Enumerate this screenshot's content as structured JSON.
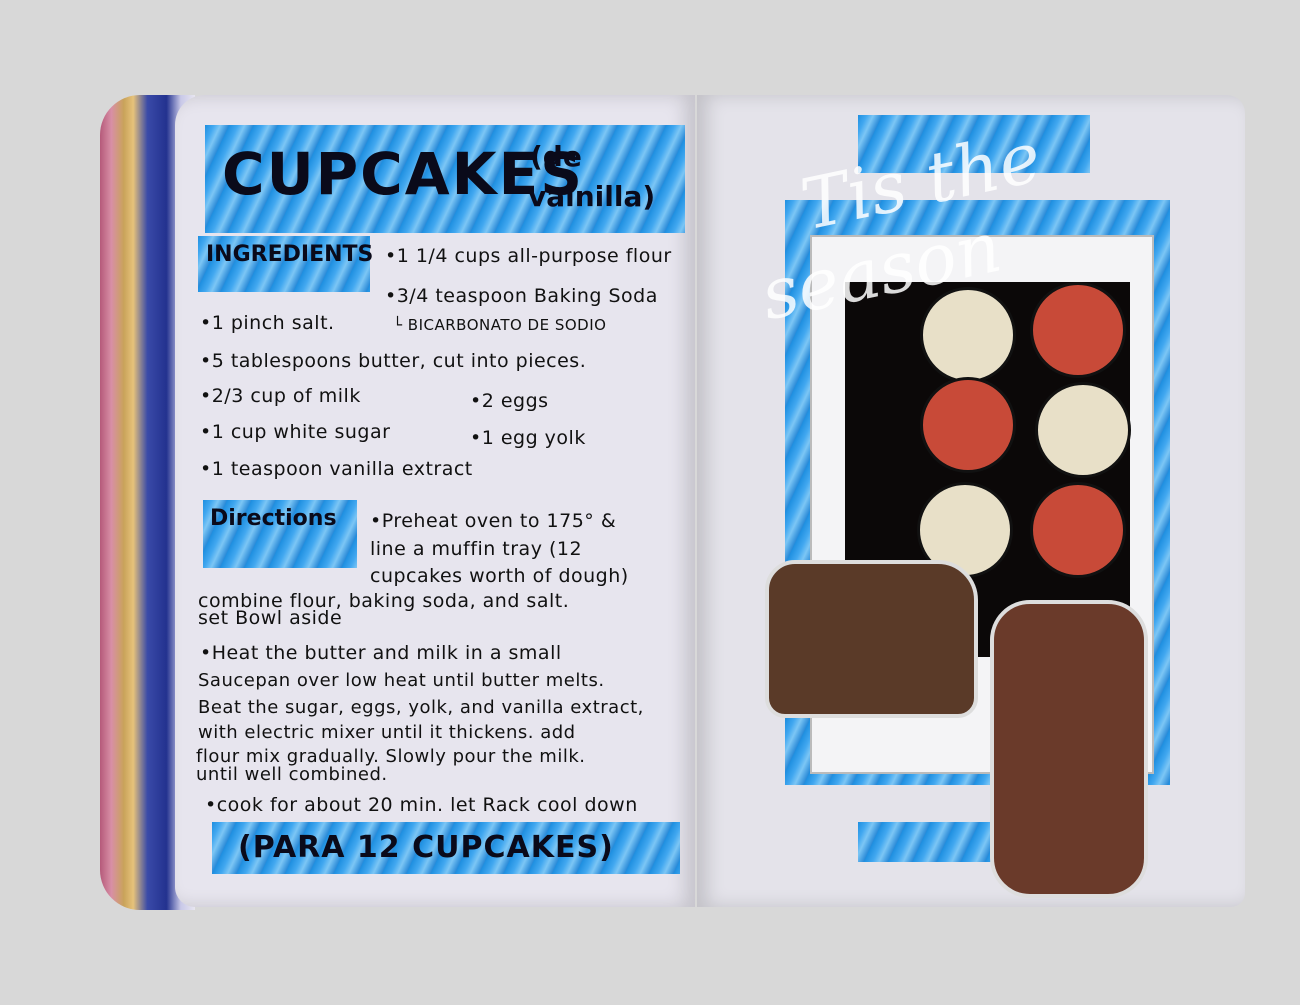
{
  "left_page": {
    "title": "CUPCAKES",
    "title_sub": [
      "(de",
      "vainilla)"
    ],
    "ingredients_label": "INGREDIENTS",
    "ingredients": [
      "•1 1/4 cups all-purpose flour",
      "•3/4 teaspoon Baking Soda",
      "└ BICARBONATO DE SODIO",
      "•1 pinch salt.",
      "•5 tablespoons butter, cut into pieces.",
      "•2/3 cup of milk",
      "•2 eggs",
      "•1 cup white sugar",
      "•1 egg yolk",
      "•1 teaspoon vanilla extract"
    ],
    "directions_label": "Directions",
    "directions": [
      "•Preheat oven to 175° &",
      "line a muffin tray (12",
      "cupcakes worth of dough)",
      "combine flour, baking soda, and salt.",
      "set Bowl aside",
      "•Heat the butter and milk in a small",
      "Saucepan over low heat until butter melts.",
      "Beat the sugar, eggs, yolk, and vanilla extract,",
      "with electric mixer until it thickens. add",
      "flour mix gradually. Slowly pour the milk.",
      "until well combined.",
      "•cook for about 20 min. let Rack cool down"
    ],
    "yield": "(PARA 12 CUPCAKES)"
  },
  "right_page": {
    "overlay_text": [
      "Tis the",
      "season"
    ]
  }
}
